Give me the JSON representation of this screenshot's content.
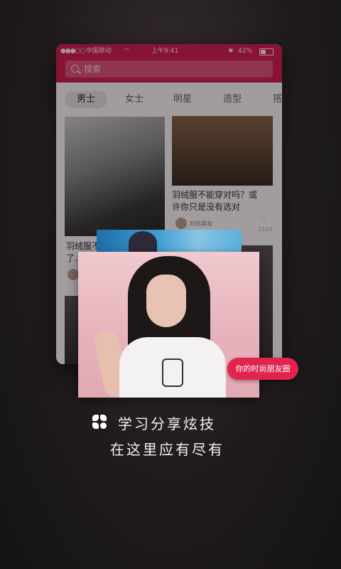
{
  "status_bar": {
    "signal": "●●●○○",
    "carrier": "中国移动",
    "time": "上午9:41",
    "bluetooth": "✱",
    "battery": "42%"
  },
  "search": {
    "placeholder": "搜索"
  },
  "tabs": [
    {
      "label": "男士",
      "active": true
    },
    {
      "label": "女士",
      "active": false
    },
    {
      "label": "明星",
      "active": false
    },
    {
      "label": "造型",
      "active": false
    },
    {
      "label": "搭配",
      "active": false
    }
  ],
  "feed": {
    "card1": {
      "caption": "羽绒服不… 一定要穿对",
      "caption_line2": "了…"
    },
    "card2": {
      "caption": "羽绒服不能穿对吗？或",
      "caption_line2": "许你只是没有选对",
      "author": "时尚美妆",
      "likes": "1534"
    }
  },
  "badge": "你的时尚朋友圈",
  "tagline": {
    "line1": "学习分享炫技",
    "line2": "在这里应有尽有"
  },
  "colors": {
    "accent": "#c11545",
    "badge": "#e0244f"
  }
}
